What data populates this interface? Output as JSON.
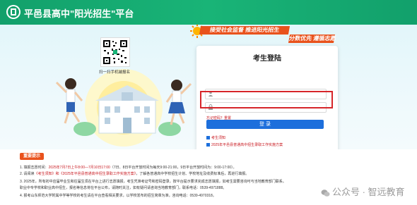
{
  "header": {
    "title": "平邑县高中\"阳光招生\"平台"
  },
  "hero": {
    "qr_caption": "扫一扫手机端报名",
    "slogan_line1": "接受社会监督 推进阳光招生",
    "slogan_line2": "分数优先 遵循志愿"
  },
  "login": {
    "title": "考生登陆",
    "forgot_label": "忘记密码？重置",
    "button_label": "登 录",
    "link1": "考生须知",
    "link2": "2025年平邑县普通高中招生录取工作实施方案"
  },
  "notice": {
    "badge": "重要提示",
    "lines": [
      {
        "plain": "1. 填报志愿时间：",
        "red": "2025年7月7日上午8:00—7月10日17:00",
        "tail": "（7日、8日平台开放时间为每天9:00-21:00，9日平台开放时间为：9:00-17:00）。"
      },
      {
        "plain": "2. 请阅读",
        "red": "《考生须知》和《2025年平邑县普通高中招生录取工作实施方案》",
        "tail": "，了解各普通高中学校招生计划、学校地址及收费标准后，再进行填报。"
      },
      {
        "plain": "3. 2025年，所有初中应届毕业生和往届生须在平台上进行志愿填报，考生凭准考证号和密码登录，按平台提示要求完成志愿填报，如考生需要咨询可与当地教育部门联系。",
        "red": "",
        "tail": ""
      },
      {
        "plain": "   职业中专学校和职业高中招生，报名等信息将在平台公布，请随时关注，如有疑问请咨询当地教育部门，联系电话：0539-4971888。",
        "red": "",
        "tail": ""
      },
      {
        "plain": "4. 报考山东师范大学附属中学等学校的考生请在平台查看相关要求，以学校发布的招生简章为准，咨询电话：0539-4970318。",
        "red": "",
        "tail": ""
      }
    ]
  },
  "watermark": "公众号 · 智远教育",
  "colors": {
    "header_green": "#19b477",
    "accent_orange": "#e9521c",
    "button_blue": "#1d6fdc",
    "highlight_red": "#d6252a"
  }
}
